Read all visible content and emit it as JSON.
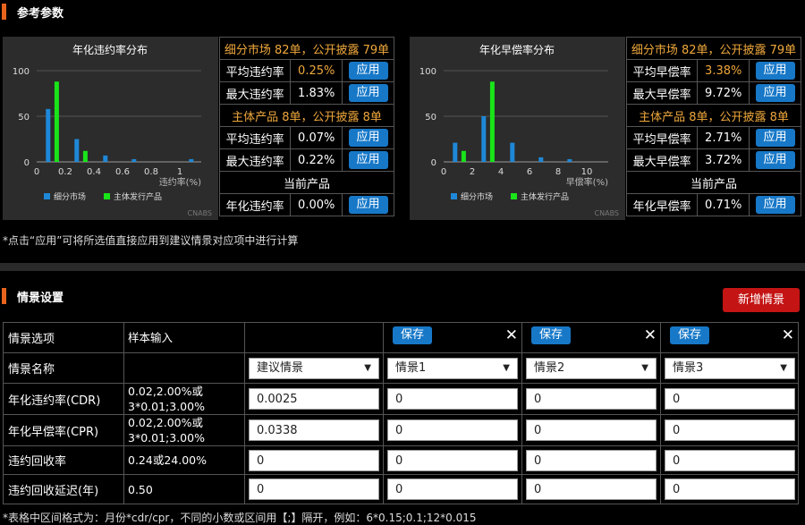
{
  "ref_section": {
    "title": "参考参数"
  },
  "cdr_chart": {
    "title": "年化违约率分布",
    "xlabel": "违约率(%)",
    "watermark": "CNABS",
    "legend": [
      "细分市场",
      "主体发行产品"
    ],
    "colors": {
      "market": "#1e88d8",
      "issuer": "#19e419",
      "axis": "#999999",
      "grid": "#555555"
    },
    "y_ticks": [
      "0",
      "50",
      "100"
    ],
    "x_ticks": [
      "0",
      "0.2",
      "0.4",
      "0.6",
      "0.8",
      "1"
    ]
  },
  "cdr_stats": {
    "market_header": "细分市场 82单，公开披露 79单",
    "rows_market": [
      {
        "label": "平均违约率",
        "value": "0.25%",
        "button": "应用"
      },
      {
        "label": "最大违约率",
        "value": "1.83%",
        "button": "应用"
      }
    ],
    "issuer_header": "主体产品 8单，公开披露 8单",
    "rows_issuer": [
      {
        "label": "平均违约率",
        "value": "0.07%",
        "button": "应用"
      },
      {
        "label": "最大违约率",
        "value": "0.22%",
        "button": "应用"
      }
    ],
    "current_header": "当前产品",
    "current_row": {
      "label": "年化违约率",
      "value": "0.00%",
      "button": "应用"
    }
  },
  "cpr_chart": {
    "title": "年化早偿率分布",
    "xlabel": "早偿率(%)",
    "watermark": "CNABS",
    "legend": [
      "细分市场",
      "主体发行产品"
    ],
    "y_ticks": [
      "0",
      "50",
      "100"
    ],
    "x_ticks": [
      "0",
      "2",
      "4",
      "6",
      "8",
      "10"
    ]
  },
  "cpr_stats": {
    "market_header": "细分市场 82单，公开披露 79单",
    "rows_market": [
      {
        "label": "平均早偿率",
        "value": "3.38%",
        "button": "应用"
      },
      {
        "label": "最大早偿率",
        "value": "9.72%",
        "button": "应用"
      }
    ],
    "issuer_header": "主体产品 8单，公开披露 8单",
    "rows_issuer": [
      {
        "label": "平均早偿率",
        "value": "2.71%",
        "button": "应用"
      },
      {
        "label": "最大早偿率",
        "value": "3.72%",
        "button": "应用"
      }
    ],
    "current_header": "当前产品",
    "current_row": {
      "label": "年化早偿率",
      "value": "0.71%",
      "button": "应用"
    }
  },
  "chart_data": [
    {
      "type": "bar",
      "title": "年化违约率分布",
      "xlabel": "违约率(%)",
      "ylim": [
        0,
        100
      ],
      "xlim": [
        0,
        1.15
      ],
      "series": [
        {
          "name": "细分市场",
          "x": [
            0.08,
            0.28,
            0.48,
            0.68,
            1.08
          ],
          "values": [
            58,
            25,
            7,
            3,
            3
          ]
        },
        {
          "name": "主体发行产品",
          "x": [
            0.14,
            0.34
          ],
          "values": [
            88,
            12
          ]
        }
      ]
    },
    {
      "type": "bar",
      "title": "年化早偿率分布",
      "xlabel": "早偿率(%)",
      "ylim": [
        0,
        100
      ],
      "xlim": [
        0,
        11.5
      ],
      "series": [
        {
          "name": "细分市场",
          "x": [
            0.8,
            2.8,
            4.8,
            6.8,
            8.8
          ],
          "values": [
            21,
            50,
            21,
            5,
            3
          ]
        },
        {
          "name": "主体发行产品",
          "x": [
            1.4,
            3.4
          ],
          "values": [
            12,
            88
          ]
        }
      ]
    }
  ],
  "ref_note": "*点击“应用”可将所选值直接应用到建议情景对应项中进行计算",
  "scenario_section": {
    "title": "情景设置",
    "add_button": "新增情景"
  },
  "scenario_table": {
    "col_header_option": "情景选项",
    "col_header_sample": "样本输入",
    "save_label": "保存",
    "close_glyph": "✕",
    "row_name_label": "情景名称",
    "scenario_names": [
      "建议情景",
      "情景1",
      "情景2",
      "情景3"
    ],
    "rows": [
      {
        "label": "年化违约率(CDR)",
        "hint": "0.02,2.00%或3*0.01;3.00%",
        "values": [
          "0.0025",
          "0",
          "0",
          "0"
        ]
      },
      {
        "label": "年化早偿率(CPR)",
        "hint": "0.02,2.00%或3*0.01;3.00%",
        "values": [
          "0.0338",
          "0",
          "0",
          "0"
        ]
      },
      {
        "label": "违约回收率",
        "hint": "0.24或24.00%",
        "values": [
          "0",
          "0",
          "0",
          "0"
        ]
      },
      {
        "label": "违约回收延迟(年)",
        "hint": "0.50",
        "values": [
          "0",
          "0",
          "0",
          "0"
        ]
      }
    ]
  },
  "bottom_note": "*表格中区间格式为：月份*cdr/cpr，不同的小数或区间用【;】隔开，例如：6*0.15;0.1;12*0.015"
}
